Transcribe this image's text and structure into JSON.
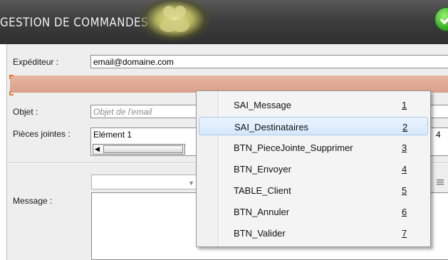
{
  "window": {
    "title": "GESTION DE COMMANDES",
    "validate_icon": "check-icon",
    "accent_green": "#3cb52a"
  },
  "form": {
    "sender": {
      "label": "Expéditeur :",
      "value": "email@domaine.com"
    },
    "recipients_band_color": "#d9a18b",
    "subject": {
      "label": "Objet :",
      "placeholder": "Objet de l'email",
      "value": ""
    },
    "attachments": {
      "label": "Pièces jointes :",
      "items": [
        "Elément 1"
      ],
      "trailing": "4"
    },
    "message": {
      "label": "Message :",
      "value": ""
    }
  },
  "context_menu": {
    "items": [
      {
        "label": "SAI_Message",
        "key": "1",
        "highlighted": false
      },
      {
        "label": "SAI_Destinataires",
        "key": "2",
        "highlighted": true
      },
      {
        "label": "BTN_PieceJointe_Supprimer",
        "key": "3",
        "highlighted": false
      },
      {
        "label": "BTN_Envoyer",
        "key": "4",
        "highlighted": false
      },
      {
        "label": "TABLE_Client",
        "key": "5",
        "highlighted": false
      },
      {
        "label": "BTN_Annuler",
        "key": "6",
        "highlighted": false
      },
      {
        "label": "BTN_Valider",
        "key": "7",
        "highlighted": false
      }
    ]
  }
}
